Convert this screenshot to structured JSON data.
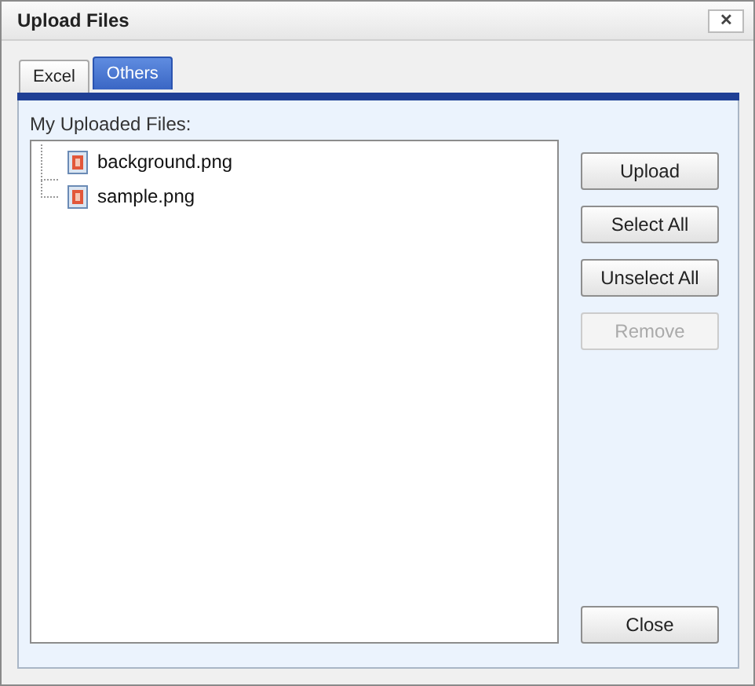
{
  "window": {
    "title": "Upload Files",
    "close": "✕"
  },
  "tabs": [
    {
      "label": "Excel",
      "selected": false
    },
    {
      "label": "Others",
      "selected": true
    }
  ],
  "list_label": "My Uploaded Files:",
  "files": [
    {
      "name": "background.png"
    },
    {
      "name": "sample.png"
    }
  ],
  "buttons": [
    {
      "label": "Upload",
      "disabled": false
    },
    {
      "label": "Select All",
      "disabled": false
    },
    {
      "label": "Unselect All",
      "disabled": false
    },
    {
      "label": "Remove",
      "disabled": true
    }
  ],
  "close_button": "Close"
}
